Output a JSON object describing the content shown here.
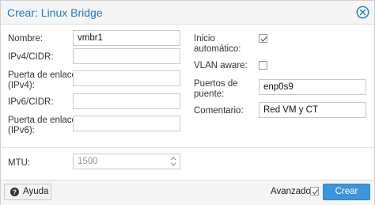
{
  "dialog": {
    "title": "Crear: Linux Bridge"
  },
  "form": {
    "name": {
      "label": "Nombre:",
      "value": "vmbr1"
    },
    "ipv4_cidr": {
      "label": "IPv4/CIDR:",
      "value": ""
    },
    "gateway_ipv4": {
      "label_line1": "Puerta de enlace",
      "label_line2": "(IPv4):",
      "value": ""
    },
    "ipv6_cidr": {
      "label": "IPv6/CIDR:",
      "value": ""
    },
    "gateway_ipv6": {
      "label_line1": "Puerta de enlace",
      "label_line2": "(IPv6):",
      "value": ""
    },
    "autostart": {
      "label_line1": "Inicio",
      "label_line2": "automático:",
      "checked": true
    },
    "vlan_aware": {
      "label": "VLAN aware:",
      "checked": false
    },
    "bridge_ports": {
      "label_line1": "Puertos de",
      "label_line2": "puente:",
      "value": "enp0s9"
    },
    "comment": {
      "label": "Comentario:",
      "value": "Red VM y CT"
    },
    "mtu": {
      "label": "MTU:",
      "placeholder": "1500"
    }
  },
  "footer": {
    "help_label": "Ayuda",
    "advanced_label": "Avanzado",
    "advanced_checked": true,
    "create_label": "Crear"
  },
  "colors": {
    "title_blue": "#1a7cc8",
    "primary_button": "#3d95dc"
  }
}
